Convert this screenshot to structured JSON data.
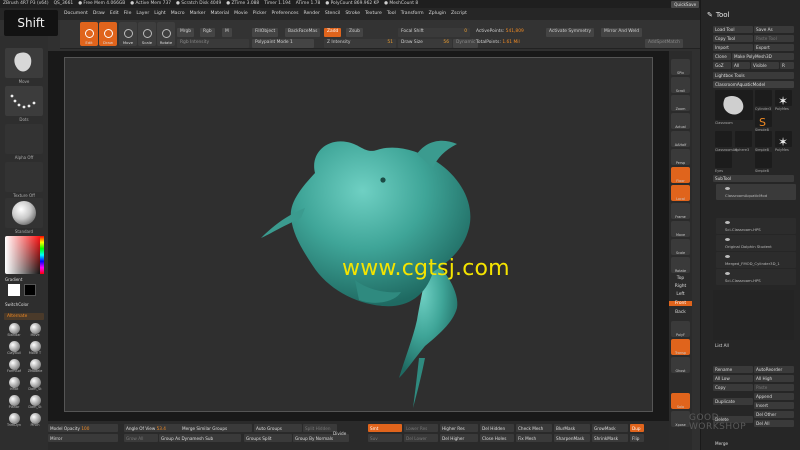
{
  "topbar": {
    "items": [
      "ZBrush 4R7 P3 (x64)",
      "QS_3661",
      "● Free Mem 4.066GB",
      "● Active Mem 737",
      "● Scratch Disk 4049",
      "● ZTime 3.088",
      "Timer 1.194",
      "ATime 1.78",
      "● PolyCount 869.962 KP",
      "● MeshCount 8"
    ],
    "quicksave": "QuickSave",
    "seethrough": "See-through 0",
    "menus": "Menus",
    "defaultzscript": "DefaultZScript"
  },
  "menubar": {
    "items": [
      "Document",
      "Draw",
      "Edit",
      "File",
      "Layer",
      "Light",
      "Macro",
      "Marker",
      "Material",
      "Movie",
      "Picker",
      "Preferences",
      "Render",
      "Stencil",
      "Stroke",
      "Texture",
      "Tool",
      "Transform",
      "Zplugin",
      "Zscript"
    ]
  },
  "shift_overlay": "Shift",
  "toolbar": {
    "buttons": [
      "Edit",
      "Draw",
      "Move",
      "Scale",
      "Rotate"
    ],
    "mrgb": "Mrgb",
    "rgb": "Rgb",
    "m": "M",
    "rgb_intensity": "Rgb Intensity",
    "fillobject": "FillObject",
    "backfacemask": "BackFaceMas",
    "zadd": "Zadd",
    "zsub": "Zsub",
    "zintensity_label": "Z Intensity",
    "zintensity_value": "51",
    "polypaint_mode": "Polypaint Mode 1",
    "focal_label": "Focal Shift",
    "focal_value": "0",
    "draw_label": "Draw Size",
    "draw_value": "56",
    "dynamic": "Dynamic",
    "activepoints_label": "ActivePoints:",
    "activepoints_value": "541,809",
    "totalpoints_label": "TotalPoints:",
    "totalpoints_value": "1.61 Mil",
    "symmetry": "Activate Symmetry",
    "mirror_weld": "Mirror And Weld",
    "addbrush": "AddSpetMatch"
  },
  "leftpanel": {
    "brush_label": "Move",
    "stroke_label": "Dots",
    "alpha_label": "Alpha Off",
    "texture_label": "Texture Off",
    "material_label": "Standard",
    "gradient": "Gradient",
    "switchcolor": "SwitchColor",
    "alternate": "Alternate",
    "brushes": [
      "Standar",
      "Move",
      "ClayBuil",
      "Move T",
      "FormSof",
      "ZModele",
      "Inflat",
      "Dam_St",
      "Planar",
      "Dam_St",
      "TrimDyn",
      "Pinch"
    ]
  },
  "watermark": "www.cgtsj.com",
  "rshelf": {
    "items": [
      "SPix",
      "Scroll",
      "Zoom",
      "Actual",
      "AAHalf",
      "Persp",
      "Floor",
      "Local",
      "Frame",
      "Move",
      "Scale",
      "Rotate",
      "PolyF",
      "Transp",
      "Ghost",
      "Solo",
      "Xpose"
    ],
    "labels": [
      "Top",
      "Right",
      "Left",
      "Front",
      "Back"
    ]
  },
  "tool": {
    "title": "Tool",
    "load": "Load Tool",
    "saveas": "Save As",
    "copy": "Copy Tool",
    "paste": "Paste Tool",
    "import": "Import",
    "export": "Export",
    "clone": "Clone",
    "make_polymesh": "Make PolyMesh3D",
    "goz": "GoZ",
    "all": "All",
    "visible": "Visible",
    "r": "R",
    "lightbox": "Lightbox  Tools",
    "current": "ClassroomAquaticModel",
    "thumbs": [
      "Classroom",
      "Cylinder3",
      "PolyMes",
      "SimpleB",
      "ClassroomAq",
      "Sphere3",
      "SimpleB",
      "PolyMes",
      "Eyes",
      "SimpleB"
    ],
    "subtool": "SubTool",
    "subtools": [
      "ClassroomAquaticMod",
      "Sci-Classroom-HPS",
      "Original Dolphin Student",
      "Merged_FMOD_Cylinder3D_1",
      "Sci-Classroom-HPS"
    ],
    "list_all": "List All",
    "rename": "Rename",
    "autoreorder": "AutoReorder",
    "all_low": "All Low",
    "all_high": "All High",
    "copy2": "Copy",
    "paste2": "Paste",
    "duplicate": "Duplicate",
    "append": "Append",
    "insert": "Insert",
    "delete": "Delete",
    "del_other": "Del Other",
    "del_all": "Del All",
    "merge": "Merge"
  },
  "bottom": {
    "model_opacity_label": "Model Opacity",
    "model_opacity_value": "100",
    "angle_label": "Angle Of View",
    "angle_value": "53.4",
    "merge_similar": "Merge Similar Groups",
    "auto_groups": "Auto Groups",
    "split_hidden": "Split Hidden",
    "divide": "Divide",
    "smt": "Smt",
    "suv": "Suv",
    "lower_res": "Lower Res",
    "higher_res": "Higher Res",
    "del_lower": "Del Lower",
    "del_higher": "Del Higher",
    "del_hidden": "Del Hidden",
    "close_holes": "Close Holes",
    "check_mesh": "Check Mesh",
    "fix_mesh": "Fix Mesh",
    "blurmask": "BlurMask",
    "growmask": "GrowMask",
    "sharpenmask": "SharpenMask",
    "shrinkmask": "ShrinkMask",
    "mirror": "Mirror",
    "grow_all": "Grow All",
    "group_dynamesh": "Group As Dynamesh Sub",
    "groups_split": "Groups Split",
    "group_normals": "Group By Normals",
    "dup": "Dup",
    "flip": "Flip",
    "reverse": "Reverse",
    "weld": "Weld"
  },
  "watermark2": [
    "GOOD",
    "WORKSHOP"
  ],
  "colors": {
    "accent": "#e0641c",
    "dolphin": "#3fa598",
    "watermark": "#f5e400"
  }
}
